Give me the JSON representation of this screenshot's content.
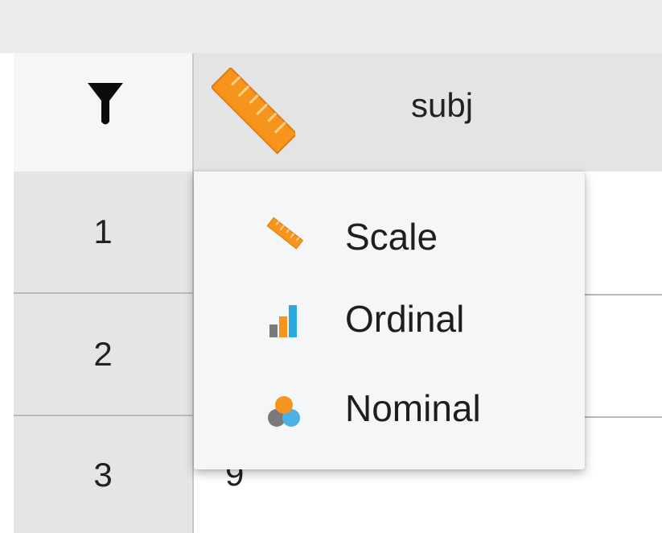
{
  "column": {
    "name": "subj",
    "measure_type_icon": "scale-ruler-icon"
  },
  "filter": {
    "icon": "filter-icon"
  },
  "rows": [
    {
      "number": "1",
      "value": ""
    },
    {
      "number": "2",
      "value": ""
    },
    {
      "number": "3",
      "value": "9"
    }
  ],
  "measure_menu": {
    "items": [
      {
        "label": "Scale",
        "icon": "scale-icon"
      },
      {
        "label": "Ordinal",
        "icon": "ordinal-icon"
      },
      {
        "label": "Nominal",
        "icon": "nominal-icon"
      }
    ]
  },
  "colors": {
    "scale_orange": "#f7941d",
    "ordinal_blue": "#29abe2",
    "ordinal_orange": "#f7941d",
    "ordinal_gray": "#7a7a7a",
    "nominal_orange": "#f7941d",
    "nominal_blue": "#4db1e6",
    "nominal_gray": "#7a7a7a"
  }
}
